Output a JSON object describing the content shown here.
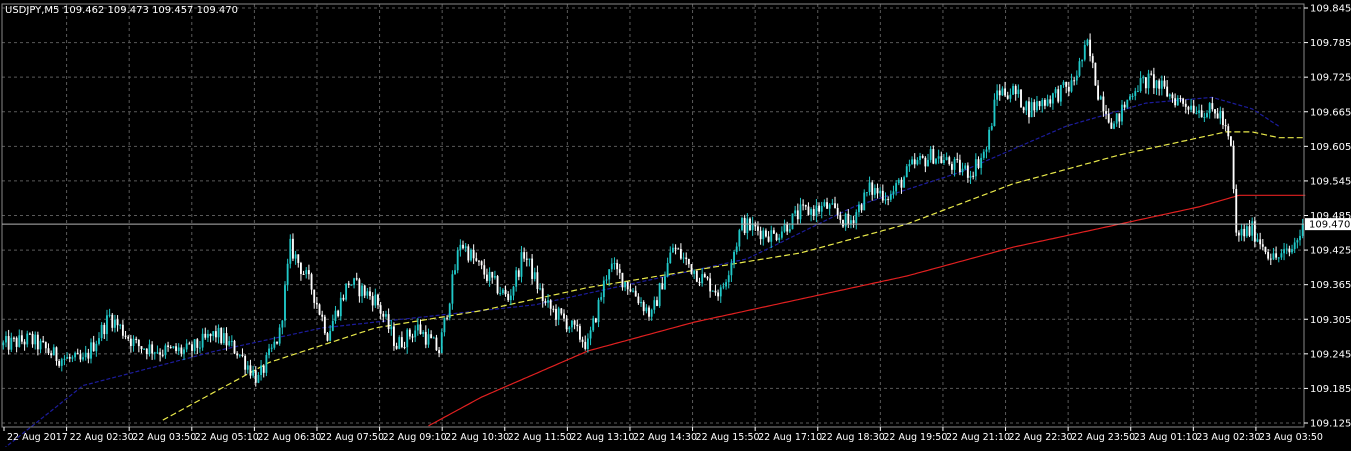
{
  "header": {
    "symbol": "USDJPY,M5",
    "ohlc": "109.462 109.473 109.457 109.470"
  },
  "colors": {
    "background": "#000000",
    "grid": "#5a5a5a",
    "axis_text": "#ffffff",
    "bull_candle": "#20c8c8",
    "bear_candle": "#ffffff",
    "ma_fast": "#1c1c9c",
    "ma_mid": "#e8e84a",
    "ma_slow": "#e02020",
    "bid_line": "#b4b4b4"
  },
  "chart_data": {
    "type": "candlestick",
    "ylim": [
      109.125,
      109.845
    ],
    "y_ticks": [
      "109.845",
      "109.785",
      "109.725",
      "109.665",
      "109.605",
      "109.545",
      "109.485",
      "109.425",
      "109.365",
      "109.305",
      "109.245",
      "109.185",
      "109.125"
    ],
    "x_ticks": [
      "22 Aug 2017",
      "22 Aug 02:30",
      "22 Aug 03:50",
      "22 Aug 05:10",
      "22 Aug 06:30",
      "22 Aug 07:50",
      "22 Aug 09:10",
      "22 Aug 10:30",
      "22 Aug 11:50",
      "22 Aug 13:10",
      "22 Aug 14:30",
      "22 Aug 15:50",
      "22 Aug 17:10",
      "22 Aug 18:30",
      "22 Aug 19:50",
      "22 Aug 21:10",
      "22 Aug 22:30",
      "22 Aug 23:50",
      "23 Aug 01:10",
      "23 Aug 02:30",
      "23 Aug 03:50"
    ],
    "current_price": "109.470",
    "grid": true,
    "close_path": [
      [
        0,
        109.26
      ],
      [
        10,
        109.27
      ],
      [
        20,
        109.24
      ],
      [
        30,
        109.23
      ],
      [
        40,
        109.31
      ],
      [
        50,
        109.26
      ],
      [
        60,
        109.25
      ],
      [
        70,
        109.25
      ],
      [
        80,
        109.28
      ],
      [
        88,
        109.25
      ],
      [
        96,
        109.2
      ],
      [
        104,
        109.28
      ],
      [
        108,
        109.43
      ],
      [
        116,
        109.36
      ],
      [
        122,
        109.28
      ],
      [
        130,
        109.37
      ],
      [
        140,
        109.34
      ],
      [
        148,
        109.26
      ],
      [
        156,
        109.29
      ],
      [
        164,
        109.25
      ],
      [
        172,
        109.44
      ],
      [
        180,
        109.39
      ],
      [
        190,
        109.34
      ],
      [
        196,
        109.42
      ],
      [
        204,
        109.33
      ],
      [
        212,
        109.3
      ],
      [
        220,
        109.26
      ],
      [
        228,
        109.4
      ],
      [
        236,
        109.36
      ],
      [
        244,
        109.31
      ],
      [
        252,
        109.43
      ],
      [
        262,
        109.38
      ],
      [
        270,
        109.35
      ],
      [
        278,
        109.47
      ],
      [
        290,
        109.45
      ],
      [
        300,
        109.49
      ],
      [
        310,
        109.5
      ],
      [
        318,
        109.47
      ],
      [
        326,
        109.53
      ],
      [
        334,
        109.52
      ],
      [
        342,
        109.57
      ],
      [
        350,
        109.59
      ],
      [
        358,
        109.57
      ],
      [
        364,
        109.56
      ],
      [
        370,
        109.6
      ],
      [
        374,
        109.7
      ],
      [
        380,
        109.7
      ],
      [
        386,
        109.67
      ],
      [
        394,
        109.69
      ],
      [
        402,
        109.71
      ],
      [
        408,
        109.78
      ],
      [
        412,
        109.7
      ],
      [
        418,
        109.64
      ],
      [
        426,
        109.71
      ],
      [
        432,
        109.72
      ],
      [
        440,
        109.69
      ],
      [
        450,
        109.67
      ],
      [
        458,
        109.66
      ],
      [
        462,
        109.6
      ],
      [
        464,
        109.45
      ],
      [
        470,
        109.46
      ],
      [
        478,
        109.41
      ],
      [
        484,
        109.42
      ],
      [
        490,
        109.47
      ]
    ],
    "ma_fast_path": [
      [
        0,
        109.08
      ],
      [
        30,
        109.19
      ],
      [
        80,
        109.25
      ],
      [
        120,
        109.29
      ],
      [
        160,
        109.31
      ],
      [
        200,
        109.33
      ],
      [
        240,
        109.37
      ],
      [
        280,
        109.41
      ],
      [
        320,
        109.5
      ],
      [
        360,
        109.56
      ],
      [
        400,
        109.64
      ],
      [
        430,
        109.68
      ],
      [
        455,
        109.69
      ],
      [
        470,
        109.67
      ],
      [
        480,
        109.64
      ]
    ],
    "ma_mid_path": [
      [
        60,
        109.13
      ],
      [
        100,
        109.23
      ],
      [
        140,
        109.29
      ],
      [
        180,
        109.32
      ],
      [
        220,
        109.36
      ],
      [
        260,
        109.39
      ],
      [
        300,
        109.42
      ],
      [
        340,
        109.47
      ],
      [
        380,
        109.54
      ],
      [
        420,
        109.59
      ],
      [
        450,
        109.62
      ],
      [
        460,
        109.63
      ],
      [
        470,
        109.63
      ],
      [
        480,
        109.62
      ],
      [
        490,
        109.62
      ]
    ],
    "ma_slow_path": [
      [
        160,
        109.12
      ],
      [
        180,
        109.17
      ],
      [
        220,
        109.25
      ],
      [
        260,
        109.3
      ],
      [
        300,
        109.34
      ],
      [
        340,
        109.38
      ],
      [
        380,
        109.43
      ],
      [
        420,
        109.47
      ],
      [
        450,
        109.5
      ],
      [
        465,
        109.52
      ],
      [
        480,
        109.52
      ],
      [
        490,
        109.52
      ]
    ],
    "bars_visible": 490
  }
}
